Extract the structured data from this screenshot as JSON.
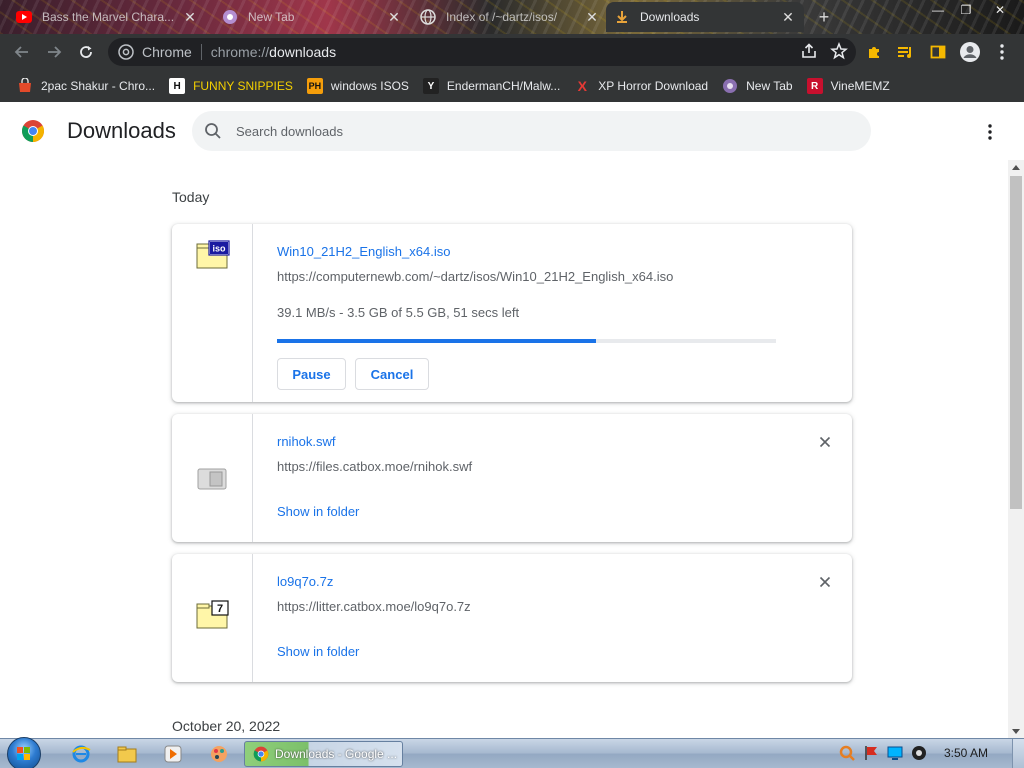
{
  "tabs": [
    {
      "title": "Bass the Marvel Chara...",
      "icon": "youtube-icon",
      "active": false
    },
    {
      "title": "New Tab",
      "icon": "new-tab-icon",
      "active": false
    },
    {
      "title": "Index of /~dartz/isos/",
      "icon": "globe-icon",
      "active": false
    },
    {
      "title": "Downloads",
      "icon": "download-icon",
      "active": true
    }
  ],
  "omnibox": {
    "site": "Chrome",
    "url_scheme": "chrome://",
    "url_path": "downloads"
  },
  "bookmarks": [
    {
      "label": "2pac Shakur - Chro...",
      "icon": "chrome-web-store-icon",
      "color": "#e24a2a"
    },
    {
      "label": "FUNNY SNIPPIES",
      "icon": "h-letter-icon",
      "badge": "H",
      "color": "#111111"
    },
    {
      "label": "windows ISOS",
      "icon": "ph-letter-icon",
      "badge": "PH",
      "color": "#f59e0b"
    },
    {
      "label": "EndermanCH/Malw...",
      "icon": "yp-letter-icon",
      "badge": "Y",
      "color": "#222222"
    },
    {
      "label": "XP Horror Download",
      "icon": "x-letter-icon",
      "badge": "X",
      "color": "#d62d20"
    },
    {
      "label": "New Tab",
      "icon": "globe-icon",
      "color": "#8a6fb0"
    },
    {
      "label": "VineMEMZ",
      "icon": "r-letter-icon",
      "badge": "R",
      "color": "#c8102e"
    }
  ],
  "page": {
    "title": "Downloads",
    "search_placeholder": "Search downloads"
  },
  "groups": [
    {
      "date": "Today",
      "items": [
        {
          "name": "Win10_21H2_English_x64.iso",
          "url": "https://computernewb.com/~dartz/isos/Win10_21H2_English_x64.iso",
          "status": "39.1 MB/s - 3.5 GB of 5.5 GB, 51 secs left",
          "progress": 0.64,
          "icon": "iso-file-icon",
          "actions": [
            "Pause",
            "Cancel"
          ]
        },
        {
          "name": "rnihok.swf",
          "url": "https://files.catbox.moe/rnihok.swf",
          "link": "Show in folder",
          "icon": "swf-file-icon"
        },
        {
          "name": "lo9q7o.7z",
          "url": "https://litter.catbox.moe/lo9q7o.7z",
          "link": "Show in folder",
          "icon": "7z-file-icon"
        }
      ]
    },
    {
      "date": "October 20, 2022",
      "items": []
    }
  ],
  "taskbar": {
    "task_title": "Downloads - Google ...",
    "clock": "3:50 AM"
  },
  "colors": {
    "accent": "#1a73e8",
    "chrome_dark": "#333536"
  }
}
